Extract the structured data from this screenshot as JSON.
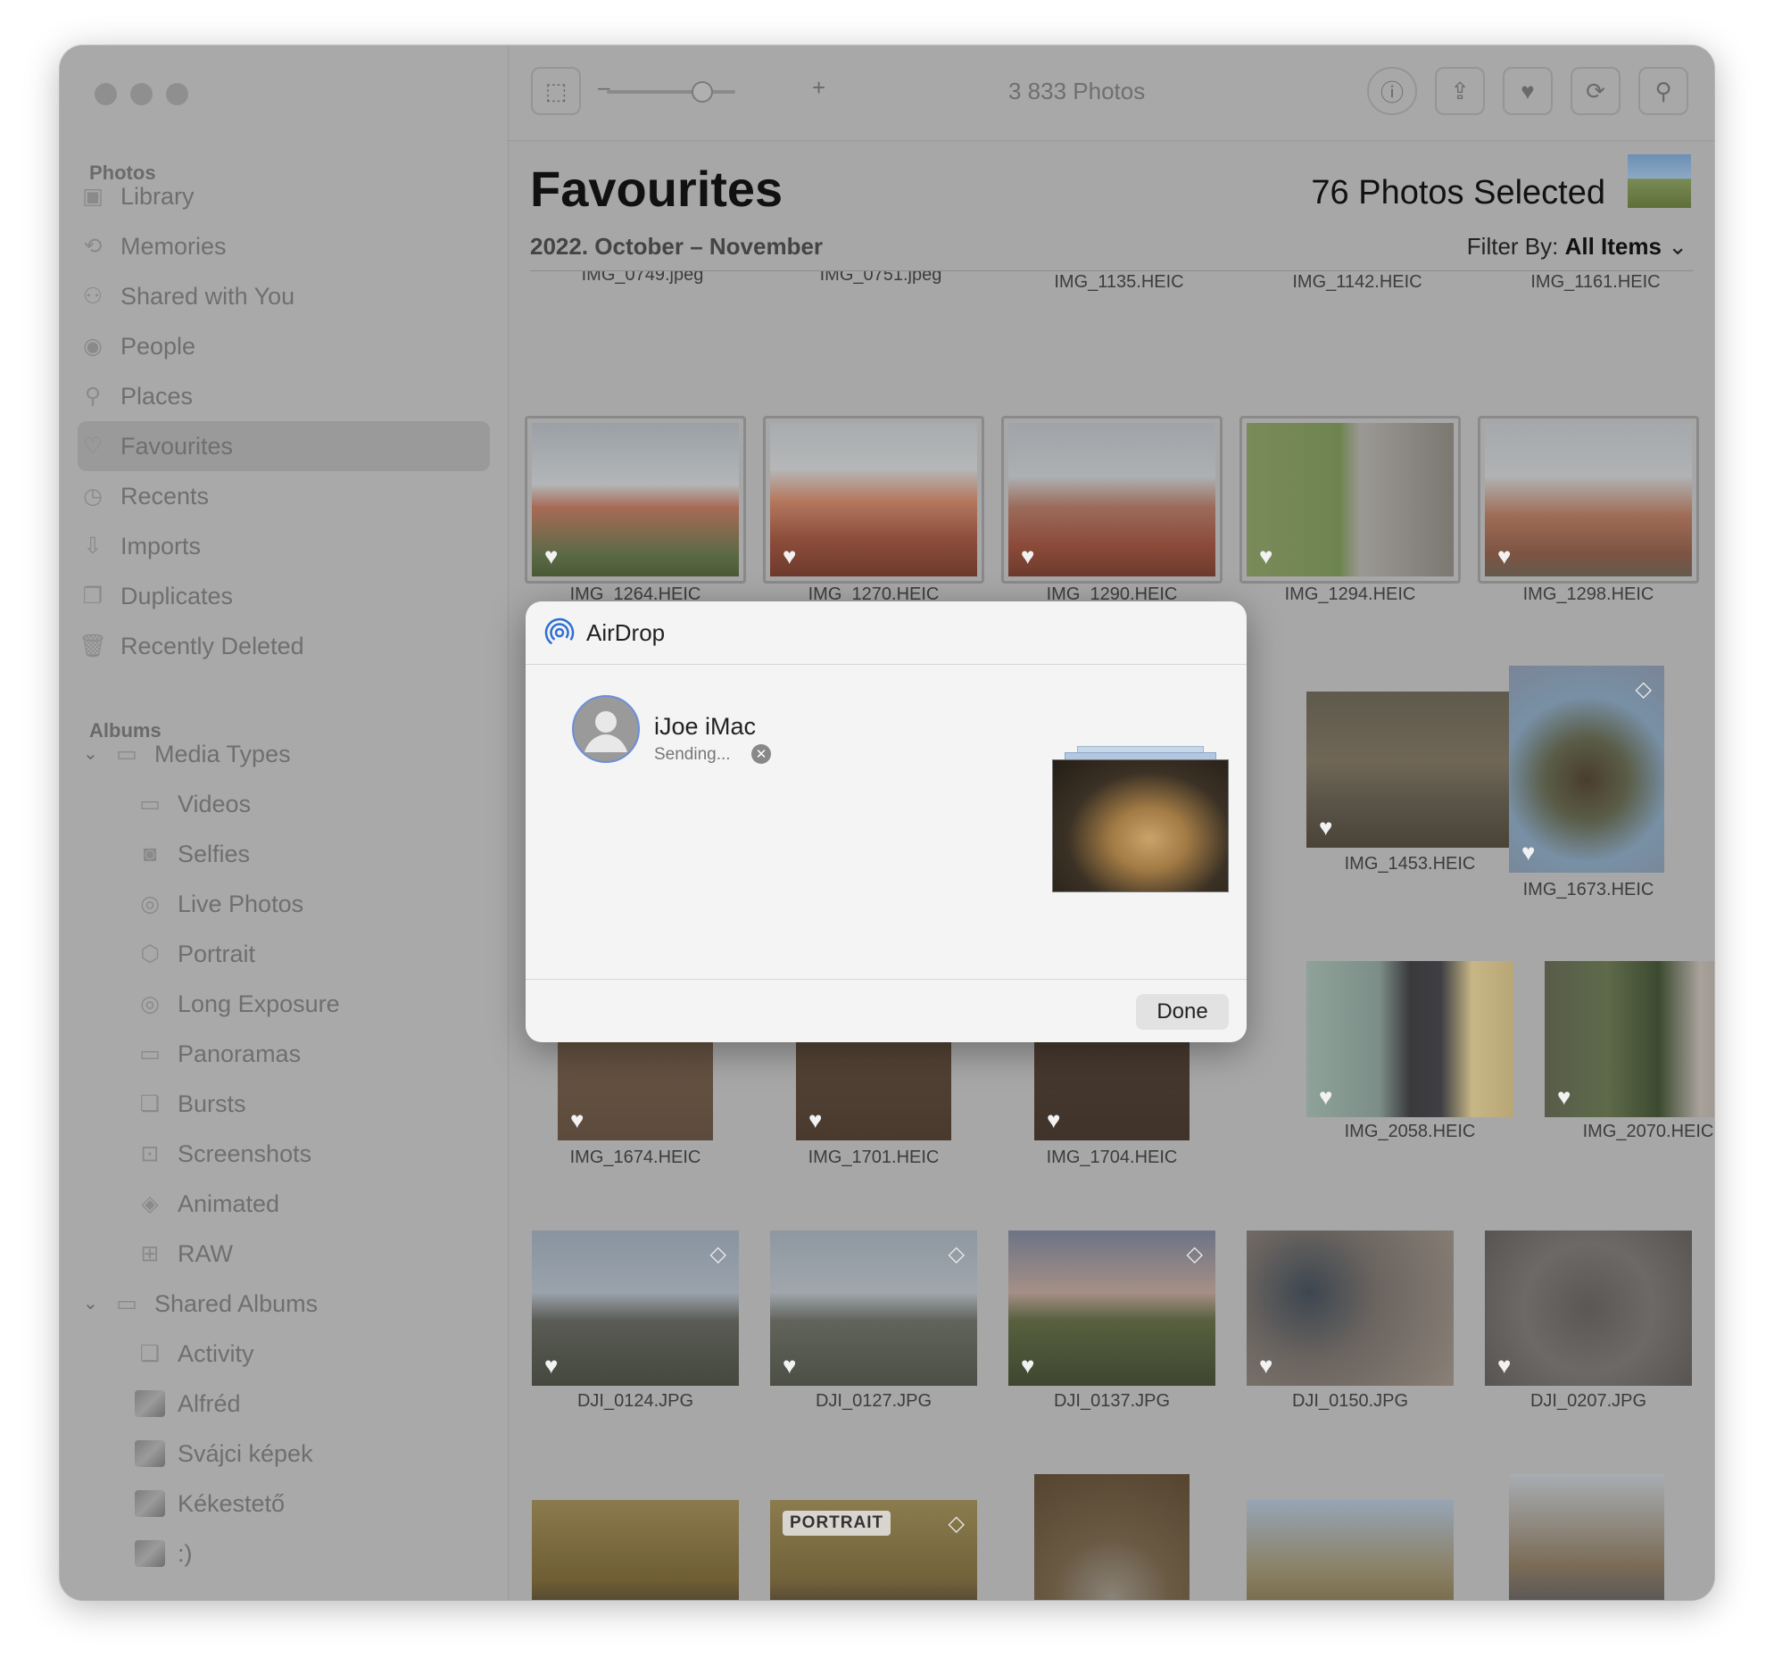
{
  "window": {
    "photo_count": "3 833 Photos"
  },
  "sidebar": {
    "section_photos": "Photos",
    "photos_items": [
      {
        "label": "Library",
        "icon": "library-icon"
      },
      {
        "label": "Memories",
        "icon": "memories-icon"
      },
      {
        "label": "Shared with You",
        "icon": "shared-with-you-icon"
      },
      {
        "label": "People",
        "icon": "people-icon"
      },
      {
        "label": "Places",
        "icon": "places-icon"
      },
      {
        "label": "Favourites",
        "icon": "heart-icon",
        "selected": true
      },
      {
        "label": "Recents",
        "icon": "clock-icon"
      },
      {
        "label": "Imports",
        "icon": "import-icon"
      },
      {
        "label": "Duplicates",
        "icon": "duplicates-icon"
      },
      {
        "label": "Recently Deleted",
        "icon": "trash-icon"
      }
    ],
    "section_albums": "Albums",
    "media_types": {
      "label": "Media Types",
      "icon": "album-stack-icon"
    },
    "media_items": [
      {
        "label": "Videos",
        "icon": "video-icon"
      },
      {
        "label": "Selfies",
        "icon": "selfie-icon"
      },
      {
        "label": "Live Photos",
        "icon": "live-photo-icon"
      },
      {
        "label": "Portrait",
        "icon": "portrait-icon"
      },
      {
        "label": "Long Exposure",
        "icon": "long-exposure-icon"
      },
      {
        "label": "Panoramas",
        "icon": "panorama-icon"
      },
      {
        "label": "Bursts",
        "icon": "bursts-icon"
      },
      {
        "label": "Screenshots",
        "icon": "screenshot-icon"
      },
      {
        "label": "Animated",
        "icon": "animated-icon"
      },
      {
        "label": "RAW",
        "icon": "raw-icon"
      }
    ],
    "shared_albums": {
      "label": "Shared Albums",
      "icon": "shared-album-icon"
    },
    "shared_items": [
      {
        "label": "Activity",
        "icon": "activity-icon"
      },
      {
        "label": "Alfréd"
      },
      {
        "label": "Svájci képek"
      },
      {
        "label": "Kékestető"
      },
      {
        "label": ":)"
      }
    ]
  },
  "header": {
    "title": "Favourites",
    "subtitle": "2022. October – November",
    "selected": "76 Photos Selected",
    "filter_prefix": "Filter By:",
    "filter_value": "All Items"
  },
  "toolbar": {
    "zoom_minus": "–",
    "zoom_plus": "+",
    "zoom_level": 0.75
  },
  "grid": {
    "top_partial": [
      "IMG_0749.jpeg",
      "IMG_0751.jpeg",
      "IMG_1135.HEIC",
      "IMG_1142.HEIC",
      "IMG_1161.HEIC"
    ],
    "row1": [
      "IMG_1264.HEIC",
      "IMG_1270.HEIC",
      "IMG_1290.HEIC",
      "IMG_1294.HEIC",
      "IMG_1298.HEIC"
    ],
    "row2": [
      "IMG_1453.HEIC",
      "IMG_1673.HEIC"
    ],
    "row3": [
      "IMG_1674.HEIC",
      "IMG_1701.HEIC",
      "IMG_1704.HEIC",
      "IMG_2058.HEIC",
      "IMG_2070.HEIC"
    ],
    "row4": [
      "DJI_0124.JPG",
      "DJI_0127.JPG",
      "DJI_0137.JPG",
      "DJI_0150.JPG",
      "DJI_0207.JPG"
    ],
    "portrait_badge": "PORTRAIT"
  },
  "airdrop": {
    "title": "AirDrop",
    "device": "iJoe iMac",
    "status": "Sending...",
    "done": "Done"
  }
}
